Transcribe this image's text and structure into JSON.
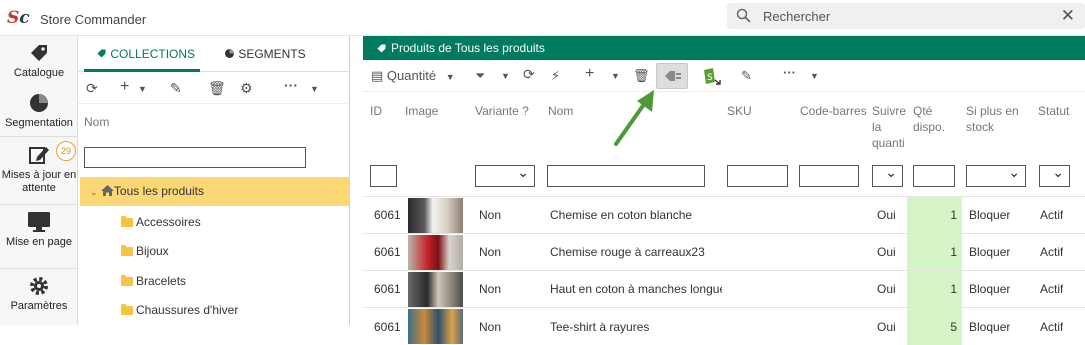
{
  "app": {
    "title": "Store Commander",
    "logo": {
      "s": "S",
      "c": "c"
    }
  },
  "search": {
    "placeholder": "Rechercher",
    "clear": "✕"
  },
  "nav": [
    {
      "label": "Catalogue",
      "icon": "tag-icon"
    },
    {
      "label": "Segmentation",
      "icon": "pie-chart-icon"
    },
    {
      "label": "Mises à jour en attente",
      "icon": "edit-icon",
      "badge": "29"
    },
    {
      "label": "Mise en page",
      "icon": "monitor-icon"
    },
    {
      "label": "Paramètres",
      "icon": "gear-icon"
    }
  ],
  "left_panel": {
    "tabs": [
      "COLLECTIONS",
      "SEGMENTS"
    ],
    "active_tab": "COLLECTIONS",
    "column_header": "Nom",
    "tree": [
      {
        "label": "Tous les produits",
        "selected": true
      },
      {
        "label": "Accessoires"
      },
      {
        "label": "Bijoux"
      },
      {
        "label": "Bracelets"
      },
      {
        "label": "Chaussures d'hiver"
      }
    ]
  },
  "grid": {
    "title": "Produits de Tous les produits",
    "view_label": "Quantité",
    "columns": {
      "id": "ID",
      "image": "Image",
      "variant": "Variante ?",
      "name": "Nom",
      "sku": "SKU",
      "barcode": "Code-barres",
      "track": "Suivre la quanti",
      "qty": "Qté dispo.",
      "oos": "Si plus en stock",
      "status": "Statut"
    },
    "rows": [
      {
        "id": "6061",
        "variant": "Non",
        "name": "Chemise en coton blanche",
        "track": "Oui",
        "qty": "1",
        "oos": "Bloquer",
        "status": "Actif"
      },
      {
        "id": "6061",
        "variant": "Non",
        "name": "Chemise rouge à carreaux23",
        "track": "Oui",
        "qty": "1",
        "oos": "Bloquer",
        "status": "Actif"
      },
      {
        "id": "6061",
        "variant": "Non",
        "name": "Haut en coton à manches longues",
        "track": "Oui",
        "qty": "1",
        "oos": "Bloquer",
        "status": "Actif"
      },
      {
        "id": "6061",
        "variant": "Non",
        "name": "Tee-shirt à rayures",
        "track": "Oui",
        "qty": "5",
        "oos": "Bloquer",
        "status": "Actif"
      }
    ]
  },
  "colors": {
    "brand_green": "#007b5e",
    "selected_row": "#fbd776",
    "qty_cell": "#d5f5c8",
    "arrow": "#4c9a3a"
  }
}
